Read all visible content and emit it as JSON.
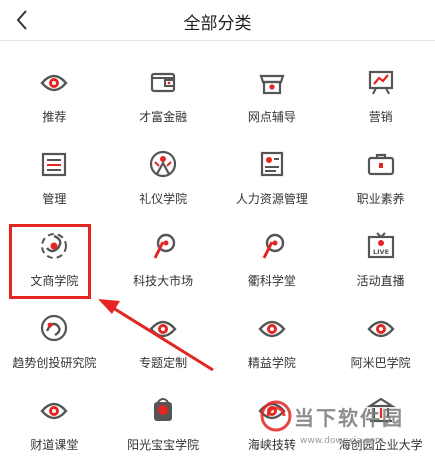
{
  "header": {
    "title": "全部分类"
  },
  "colors": {
    "accent": "#e32622",
    "icon_gray": "#555555",
    "icon_red": "#e32622"
  },
  "categories": [
    {
      "label": "推荐",
      "icon": "eye-shield-icon"
    },
    {
      "label": "才富金融",
      "icon": "wallet-icon"
    },
    {
      "label": "网点辅导",
      "icon": "store-icon"
    },
    {
      "label": "营销",
      "icon": "presentation-chart-icon"
    },
    {
      "label": "管理",
      "icon": "list-panel-icon"
    },
    {
      "label": "礼仪学院",
      "icon": "person-etiquette-icon"
    },
    {
      "label": "人力资源管理",
      "icon": "id-card-icon"
    },
    {
      "label": "职业素养",
      "icon": "briefcase-icon"
    },
    {
      "label": "文商学院",
      "icon": "swirl-emblem-icon"
    },
    {
      "label": "科技大市场",
      "icon": "tech-emblem-icon"
    },
    {
      "label": "衢科学堂",
      "icon": "tech-emblem-icon"
    },
    {
      "label": "活动直播",
      "icon": "live-tv-icon"
    },
    {
      "label": "趋势创投研究院",
      "icon": "trend-emblem-icon"
    },
    {
      "label": "专题定制",
      "icon": "eye-shield-icon"
    },
    {
      "label": "精益学院",
      "icon": "eye-shield-icon"
    },
    {
      "label": "阿米巴学院",
      "icon": "eye-shield-icon"
    },
    {
      "label": "财道课堂",
      "icon": "eye-shield-icon"
    },
    {
      "label": "阳光宝宝学院",
      "icon": "baby-bag-icon"
    },
    {
      "label": "海峡技转",
      "icon": "eye-shield-icon"
    },
    {
      "label": "海创园企业大学",
      "icon": "bank-emblem-icon"
    }
  ],
  "watermark": {
    "text": "当下软件园",
    "url": "www.downxia.com"
  }
}
